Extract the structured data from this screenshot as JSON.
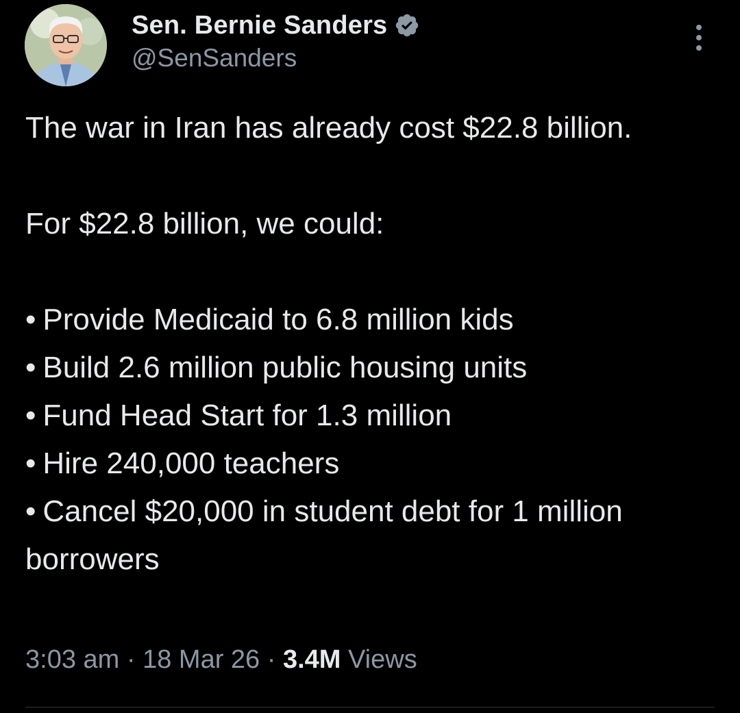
{
  "author": {
    "display_name": "Sen. Bernie Sanders",
    "handle": "@SenSanders",
    "verified_icon": "verified-badge-icon",
    "avatar_icon": "profile-photo"
  },
  "tweet": {
    "paragraphs": [
      "The war in Iran has already cost $22.8 billion.",
      "For $22.8 billion, we could:"
    ],
    "bullet_char": "•",
    "bullets": [
      "Provide Medicaid to 6.8 million kids",
      "Build 2.6 million public housing units",
      "Fund Head Start for 1.3 million",
      "Hire 240,000 teachers",
      "Cancel $20,000 in student debt for 1 million borrowers"
    ]
  },
  "meta": {
    "time": "3:03 am",
    "separator": "·",
    "date": "18 Mar 26",
    "views_count": "3.4M",
    "views_label": "Views"
  },
  "colors": {
    "background": "#000000",
    "text_primary": "#e7e9ea",
    "text_secondary": "#8b98a5",
    "verified": "#8b98a5",
    "divider": "#2f3336"
  },
  "menu": {
    "more_icon": "more-vertical-icon"
  }
}
